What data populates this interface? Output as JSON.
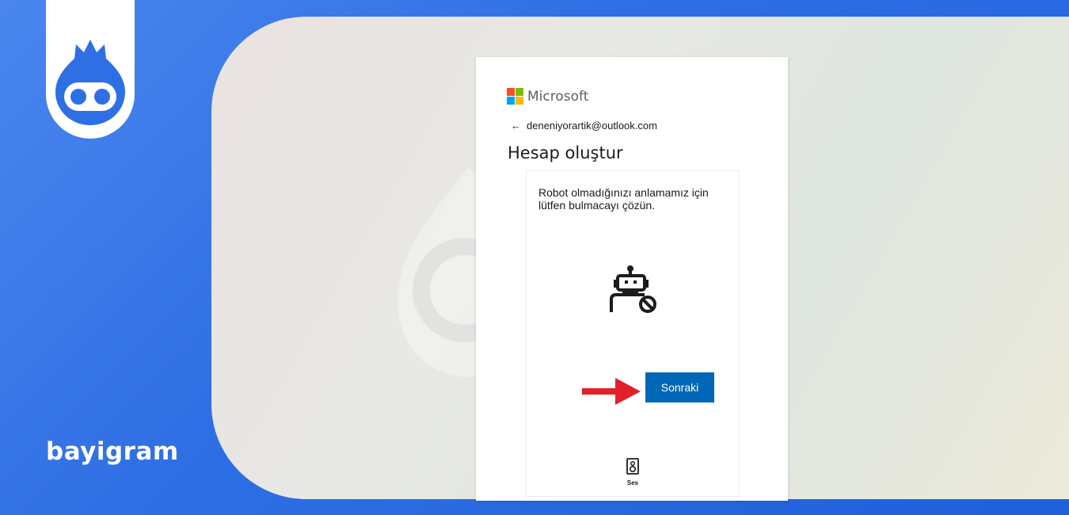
{
  "brand": {
    "name": "bayigram"
  },
  "colors": {
    "accent": "#0067b8",
    "page_bg": "#2f6fe4",
    "annotation_arrow": "#e3202a"
  },
  "microsoft": {
    "logo_text": "Microsoft"
  },
  "account": {
    "email": "deneniyorartik@outlook.com",
    "back_icon": "arrow-left-icon"
  },
  "page": {
    "title": "Hesap oluştur"
  },
  "challenge": {
    "instruction": "Robot olmadığınızı anlamamız için lütfen bulmacayı çözün.",
    "icon": "robot-blocked-icon",
    "next_label": "Sonraki",
    "audio_label": "Ses",
    "audio_icon": "speaker-icon"
  }
}
